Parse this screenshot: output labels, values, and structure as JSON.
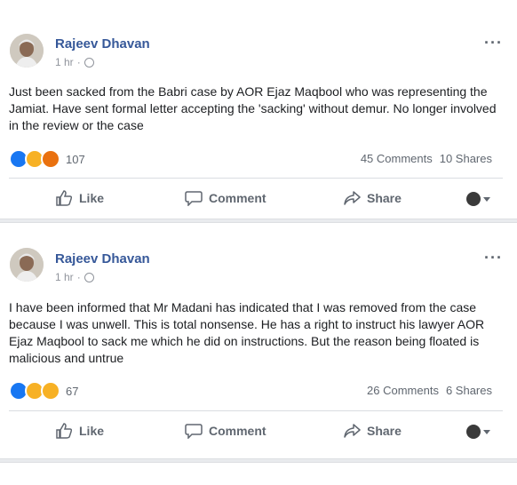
{
  "posts": [
    {
      "author": "Rajeev Dhavan",
      "time": "1 hr",
      "separator": "·",
      "text": "Just been sacked from the Babri case by AOR Ejaz Maqbool who was representing the Jamiat. Have sent formal letter accepting the 'sacking' without demur. No longer involved in the review or the case",
      "reaction_icons": [
        "like-reaction-icon",
        "sad-reaction-icon",
        "angry-reaction-icon"
      ],
      "reaction_count": "107",
      "comments": "45 Comments",
      "shares": "10 Shares"
    },
    {
      "author": "Rajeev Dhavan",
      "time": "1 hr",
      "separator": "·",
      "text": "I have been informed that Mr Madani has indicated that I was removed from the case because I was unwell. This is total nonsense. He has a right to instruct his lawyer AOR Ejaz Maqbool to sack me which he did on instructions. But the reason being floated is malicious and untrue",
      "reaction_icons": [
        "like-reaction-icon",
        "sad-reaction-icon",
        "haha-reaction-icon"
      ],
      "reaction_count": "67",
      "comments": "26 Comments",
      "shares": "6 Shares"
    }
  ],
  "actions": {
    "like": "Like",
    "comment": "Comment",
    "share": "Share"
  },
  "more_glyph": "···",
  "colors": {
    "author_link": "#365899",
    "meta_grey": "#90949c",
    "action_grey": "#606770",
    "like_blue": "#1877f2",
    "reaction_yellow": "#f7b125",
    "angry_orange": "#e9710f"
  }
}
